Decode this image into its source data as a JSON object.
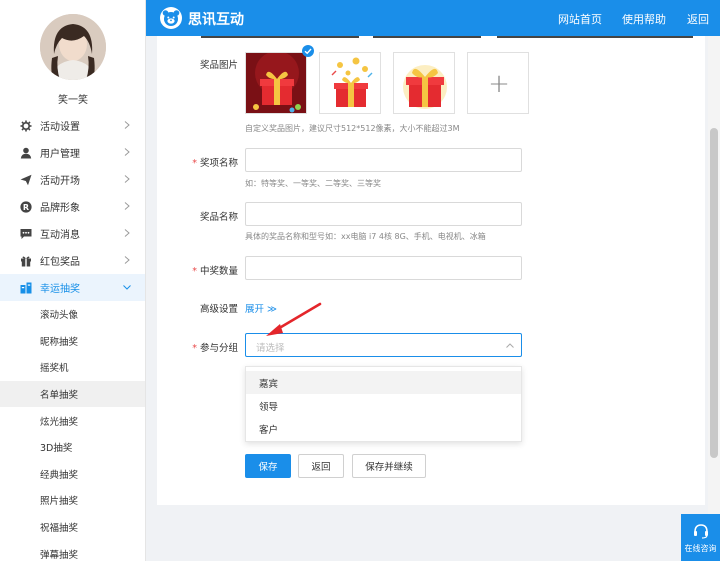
{
  "sidebar": {
    "username": "笑一笑",
    "menu": [
      {
        "label": "活动设置",
        "icon": "gear-icon"
      },
      {
        "label": "用户管理",
        "icon": "user-icon"
      },
      {
        "label": "活动开场",
        "icon": "send-icon"
      },
      {
        "label": "品牌形象",
        "icon": "registered-icon"
      },
      {
        "label": "互动消息",
        "icon": "message-icon"
      },
      {
        "label": "红包奖品",
        "icon": "gift-icon"
      },
      {
        "label": "幸运抽奖",
        "icon": "lottery-icon"
      }
    ],
    "submenu": [
      "滚动头像",
      "昵称抽奖",
      "摇奖机",
      "名单抽奖",
      "炫光抽奖",
      "3D抽奖",
      "经典抽奖",
      "照片抽奖",
      "祝福抽奖",
      "弹幕抽奖"
    ],
    "active_submenu": "名单抽奖"
  },
  "header": {
    "brand": "思讯互动",
    "nav": [
      "网站首页",
      "使用帮助",
      "返回"
    ]
  },
  "form": {
    "prize_image_label": "奖品图片",
    "prize_image_hint": "自定义奖品图片，建议尺寸512*512像素，大小不能超过3M",
    "add_symbol": "+",
    "prize_name_label": "奖项名称",
    "prize_name_hint": "如：特等奖、一等奖、二等奖、三等奖",
    "item_name_label": "奖品名称",
    "item_name_hint": "具体的奖品名称和型号如：xx电脑 i7 4核 8G、手机、电视机、冰箱",
    "winner_count_label": "中奖数量",
    "advanced_label": "高级设置",
    "expand_label": "展开 ≫",
    "group_label": "参与分组",
    "group_placeholder": "请选择",
    "group_options": [
      "嘉宾",
      "领导",
      "客户"
    ],
    "required_mark": "*"
  },
  "buttons": {
    "save": "保存",
    "back": "返回",
    "save_continue": "保存并继续"
  },
  "chat": {
    "label": "在线咨询"
  },
  "colors": {
    "primary": "#1a8ee9",
    "required": "#e94b4b"
  }
}
